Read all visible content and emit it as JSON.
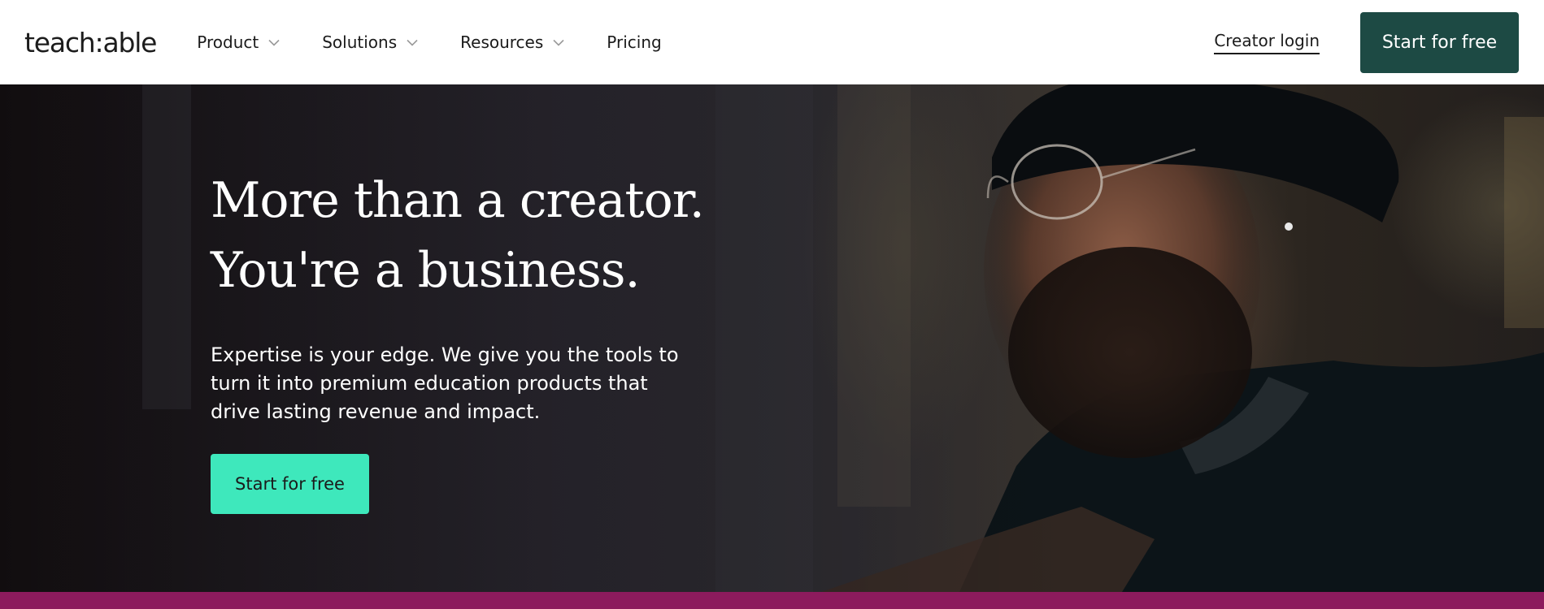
{
  "header": {
    "logo_text": "teach:able",
    "nav": [
      {
        "label": "Product",
        "has_dropdown": true,
        "icon": "chevron-down-icon"
      },
      {
        "label": "Solutions",
        "has_dropdown": true,
        "icon": "chevron-down-icon"
      },
      {
        "label": "Resources",
        "has_dropdown": true,
        "icon": "chevron-down-icon"
      },
      {
        "label": "Pricing",
        "has_dropdown": false
      }
    ],
    "creator_login_label": "Creator login",
    "cta_label": "Start for free"
  },
  "hero": {
    "title_line1": "More than a creator.",
    "title_line2": "You're a business.",
    "subtitle": "Expertise is your edge. We give you the tools to turn it into premium education products that drive lasting revenue and impact.",
    "cta_label": "Start for free"
  },
  "colors": {
    "brand_dark_green": "#1d4a44",
    "accent_mint": "#3ee8bc",
    "band_magenta": "#8c1b5d"
  }
}
